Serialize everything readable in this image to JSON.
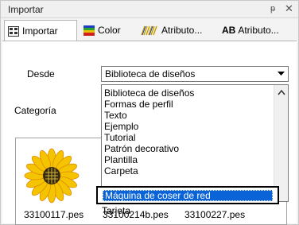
{
  "window": {
    "title": "Importar",
    "pin_glyph": "ᵽ",
    "close_glyph": "✕"
  },
  "tabs": [
    {
      "label": "Importar",
      "icon": "import-icon",
      "active": true
    },
    {
      "label": "Color",
      "icon": "color-icon",
      "active": false
    },
    {
      "label": "Atributo...",
      "icon": "stitch-attribute-icon",
      "active": false
    },
    {
      "label": "Atributo...",
      "prefix": "AB",
      "icon": "text-attribute-icon",
      "active": false
    }
  ],
  "form": {
    "desde_label": "Desde",
    "categoria_label": "Categoría",
    "desde_value": "Biblioteca de diseños"
  },
  "dropdown": {
    "items": [
      "Biblioteca de diseños",
      "Formas de perfil",
      "Texto",
      "Ejemplo",
      "Tutorial",
      "Patrón decorativo",
      "Plantilla",
      "Carpeta"
    ],
    "selected": "Máquina de coser de red",
    "after_selected": "Tarjeta"
  },
  "files": [
    "33100117.pes",
    "33100214b.pes",
    "33100227.pes"
  ],
  "colors": {
    "selection": "#0a64d8",
    "petal": "#f5c400",
    "petal_edge": "#e08a00",
    "center": "#3a2a10"
  }
}
